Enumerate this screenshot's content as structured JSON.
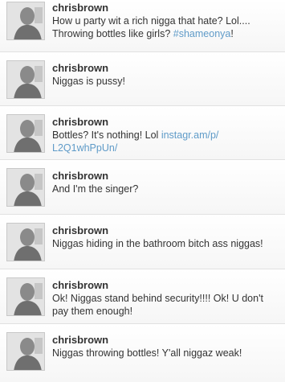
{
  "tweets": [
    {
      "username": "chrisbrown",
      "text": "How u party wit a rich nigga that hate? Lol.... Throwing bottles like girls? ",
      "hashtag": "#shameonya",
      "after": "!"
    },
    {
      "username": "chrisbrown",
      "text": "Niggas is pussy!"
    },
    {
      "username": "chrisbrown",
      "text": "Bottles? It's nothing! Lol ",
      "link": "instagr.am/p/ L2Q1whPpUn/"
    },
    {
      "username": "chrisbrown",
      "text": "And I'm the singer?"
    },
    {
      "username": "chrisbrown",
      "text": "Niggas hiding in the bathroom bitch ass niggas!"
    },
    {
      "username": "chrisbrown",
      "text": "Ok! Niggas stand behind security!!!! Ok! U don't pay them enough!"
    },
    {
      "username": "chrisbrown",
      "text": "Niggas throwing bottles! Y'all niggaz weak!"
    }
  ],
  "colors": {
    "link": "#5f9bc8",
    "text": "#333333",
    "divider": "#e1e1e1"
  },
  "icons": {
    "avatar": "profile-photo"
  }
}
